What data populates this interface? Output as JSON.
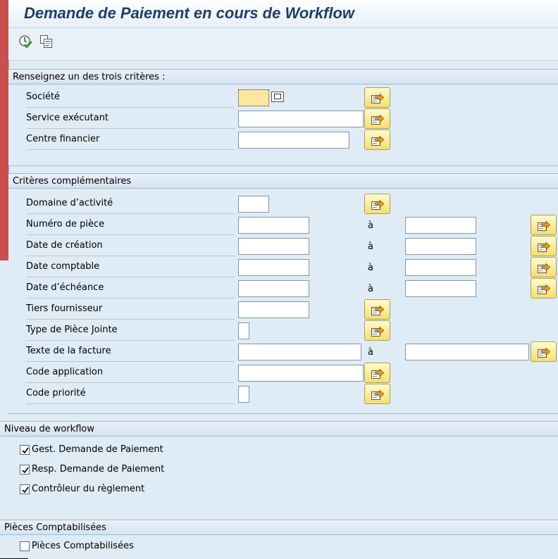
{
  "window": {
    "title": "Demande de Paiement en cours de Workflow"
  },
  "toolbar": {
    "icons": [
      "execute-icon",
      "multiple-selection-icon"
    ]
  },
  "group1": {
    "title": "Renseignez un des trois critères :",
    "fields": [
      {
        "label": "Société",
        "value": "",
        "required": true
      },
      {
        "label": "Service exécutant",
        "value": ""
      },
      {
        "label": "Centre financier",
        "value": ""
      }
    ]
  },
  "group2": {
    "title": "Critères complémentaires",
    "fields": [
      {
        "label": "Domaine d’activité",
        "value": ""
      },
      {
        "label": "Numéro de pièce",
        "from": "",
        "to_label": "à",
        "to": ""
      },
      {
        "label": "Date de création",
        "from": "",
        "to_label": "à",
        "to": ""
      },
      {
        "label": "Date comptable",
        "from": "",
        "to_label": "à",
        "to": ""
      },
      {
        "label": "Date d’échéance",
        "from": "",
        "to_label": "à",
        "to": ""
      },
      {
        "label": "Tiers fournisseur",
        "value": ""
      },
      {
        "label": "Type de Pièce Jointe",
        "value": ""
      },
      {
        "label": "Texte de la facture",
        "from": "",
        "to_label": "à",
        "to": ""
      },
      {
        "label": "Code application",
        "value": ""
      },
      {
        "label": "Code priorité",
        "value": ""
      }
    ]
  },
  "group3": {
    "title": "Niveau de workflow",
    "checkboxes": [
      {
        "label": "Gest. Demande de Paiement",
        "checked": true
      },
      {
        "label": "Resp. Demande de Paiement",
        "checked": true
      },
      {
        "label": "Contrôleur du règlement",
        "checked": true
      }
    ]
  },
  "group4": {
    "title": "Pièces Comptabilisées",
    "checkboxes": [
      {
        "label": "Pièces Comptabilisées",
        "checked": false
      }
    ]
  },
  "colors": {
    "title": "#1b3f6b",
    "required_field": "#fde6a0",
    "accent_strip": "#c9504d",
    "background": "#dfebf5"
  }
}
